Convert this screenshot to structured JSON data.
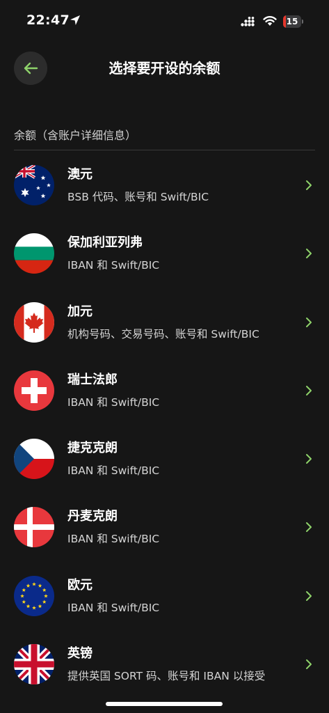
{
  "status_bar": {
    "time": "22:47",
    "battery_level": "15",
    "battery_fraction": 0.15,
    "battery_color": "#e5372c"
  },
  "header": {
    "title": "选择要开设的余额"
  },
  "section": {
    "title": "余额（含账户详细信息）"
  },
  "colors": {
    "background": "#161616",
    "accent": "#8ed26a",
    "secondary_text": "#d4d4d4"
  },
  "currencies": [
    {
      "name": "澳元",
      "description": "BSB 代码、账号和 Swift/BIC",
      "flag_icon": "australia-flag-icon"
    },
    {
      "name": "保加利亚列弗",
      "description": "IBAN 和 Swift/BIC",
      "flag_icon": "bulgaria-flag-icon"
    },
    {
      "name": "加元",
      "description": "机构号码、交易号码、账号和 Swift/BIC",
      "flag_icon": "canada-flag-icon"
    },
    {
      "name": "瑞士法郎",
      "description": "IBAN 和 Swift/BIC",
      "flag_icon": "switzerland-flag-icon"
    },
    {
      "name": "捷克克朗",
      "description": "IBAN 和 Swift/BIC",
      "flag_icon": "czech-flag-icon"
    },
    {
      "name": "丹麦克朗",
      "description": "IBAN 和 Swift/BIC",
      "flag_icon": "denmark-flag-icon"
    },
    {
      "name": "欧元",
      "description": "IBAN 和 Swift/BIC",
      "flag_icon": "eu-flag-icon"
    },
    {
      "name": "英镑",
      "description": "提供英国 SORT 码、账号和 IBAN 以接受",
      "flag_icon": "uk-flag-icon"
    }
  ]
}
